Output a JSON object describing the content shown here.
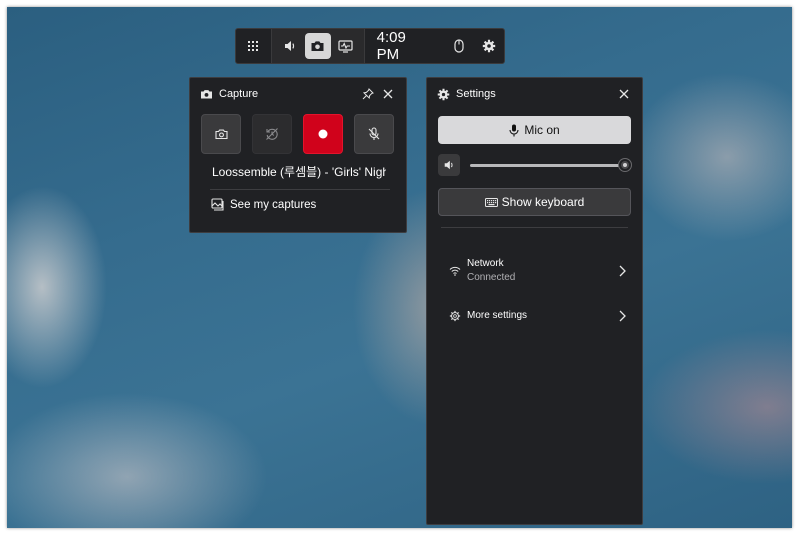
{
  "gamebar": {
    "time": "4:09 PM",
    "icons": [
      "widgets-icon",
      "volume-icon",
      "camera-icon",
      "performance-icon",
      "mouse-icon",
      "gear-icon"
    ]
  },
  "capture": {
    "title": "Capture",
    "media_title": "Loossemble (루셈블) - 'Girls' Nigh...",
    "see_captures": "See my captures",
    "record_color": "#d0021b"
  },
  "settings": {
    "title": "Settings",
    "mic_label": "Mic on",
    "volume_level": 1.0,
    "keyboard_label": "Show keyboard",
    "network_label": "Network",
    "network_status": "Connected",
    "more_settings_label": "More settings"
  }
}
